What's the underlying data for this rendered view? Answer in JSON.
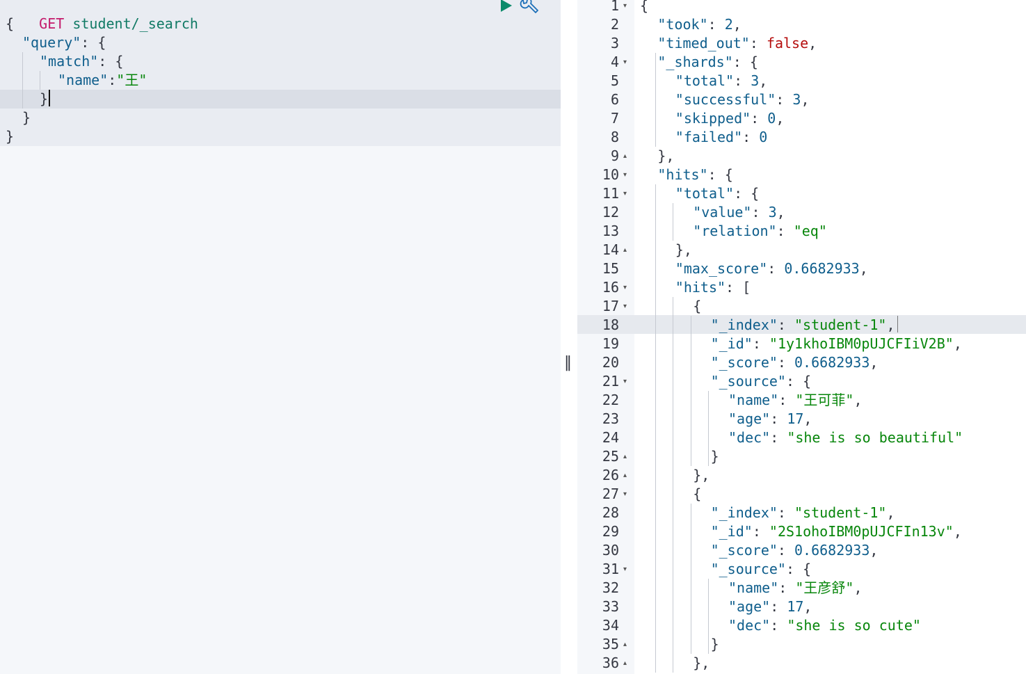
{
  "request": {
    "method": "GET",
    "path": "student/_search",
    "lines": [
      {
        "indent": 0,
        "key": "",
        "text": "{",
        "value": ""
      },
      {
        "indent": 2,
        "key": "\"query\"",
        "text": ": {",
        "value": ""
      },
      {
        "indent": 4,
        "key": "\"match\"",
        "text": ": {",
        "value": ""
      },
      {
        "indent": 6,
        "key": "\"name\"",
        "text": ":",
        "value": "\"王\""
      },
      {
        "indent": 4,
        "key": "",
        "text": "}",
        "value": ""
      },
      {
        "indent": 2,
        "key": "",
        "text": "}",
        "value": ""
      },
      {
        "indent": 0,
        "key": "",
        "text": "}",
        "value": ""
      }
    ]
  },
  "icons": {
    "run": "play-icon",
    "settings": "wrench-icon",
    "resize": "resize-handle-icon"
  },
  "resizer_glyph": "‖",
  "response": {
    "line_numbers": [
      "1",
      "2",
      "3",
      "4",
      "5",
      "6",
      "7",
      "8",
      "9",
      "10",
      "11",
      "12",
      "13",
      "14",
      "15",
      "16",
      "17",
      "18",
      "19",
      "20",
      "21",
      "22",
      "23",
      "24",
      "25",
      "26",
      "27",
      "28",
      "29",
      "30",
      "31",
      "32",
      "33",
      "34",
      "35",
      "36"
    ],
    "folds": [
      "▾",
      "",
      "",
      "▾",
      "",
      "",
      "",
      "",
      "▴",
      "▾",
      "▾",
      "",
      "",
      "▴",
      "",
      "▾",
      "▾",
      "",
      "",
      "",
      "▾",
      "",
      "",
      "",
      "▴",
      "▴",
      "▾",
      "",
      "",
      "",
      "▾",
      "",
      "",
      "",
      "▴",
      "▴"
    ],
    "lines": [
      {
        "i": 0,
        "k": "",
        "sep": "{",
        "v": "",
        "vt": ""
      },
      {
        "i": 2,
        "k": "\"took\"",
        "sep": ": ",
        "v": "2",
        "vt": "num",
        "tail": ","
      },
      {
        "i": 2,
        "k": "\"timed_out\"",
        "sep": ": ",
        "v": "false",
        "vt": "bool",
        "tail": ","
      },
      {
        "i": 2,
        "k": "\"_shards\"",
        "sep": ": {",
        "v": "",
        "vt": ""
      },
      {
        "i": 4,
        "k": "\"total\"",
        "sep": ": ",
        "v": "3",
        "vt": "num",
        "tail": ","
      },
      {
        "i": 4,
        "k": "\"successful\"",
        "sep": ": ",
        "v": "3",
        "vt": "num",
        "tail": ","
      },
      {
        "i": 4,
        "k": "\"skipped\"",
        "sep": ": ",
        "v": "0",
        "vt": "num",
        "tail": ","
      },
      {
        "i": 4,
        "k": "\"failed\"",
        "sep": ": ",
        "v": "0",
        "vt": "num"
      },
      {
        "i": 2,
        "k": "",
        "sep": "},",
        "v": "",
        "vt": ""
      },
      {
        "i": 2,
        "k": "\"hits\"",
        "sep": ": {",
        "v": "",
        "vt": ""
      },
      {
        "i": 4,
        "k": "\"total\"",
        "sep": ": {",
        "v": "",
        "vt": ""
      },
      {
        "i": 6,
        "k": "\"value\"",
        "sep": ": ",
        "v": "3",
        "vt": "num",
        "tail": ","
      },
      {
        "i": 6,
        "k": "\"relation\"",
        "sep": ": ",
        "v": "\"eq\"",
        "vt": "str"
      },
      {
        "i": 4,
        "k": "",
        "sep": "},",
        "v": "",
        "vt": ""
      },
      {
        "i": 4,
        "k": "\"max_score\"",
        "sep": ": ",
        "v": "0.6682933",
        "vt": "num",
        "tail": ","
      },
      {
        "i": 4,
        "k": "\"hits\"",
        "sep": ": [",
        "v": "",
        "vt": ""
      },
      {
        "i": 6,
        "k": "",
        "sep": "{",
        "v": "",
        "vt": ""
      },
      {
        "i": 8,
        "k": "\"_index\"",
        "sep": ": ",
        "v": "\"student-1\"",
        "vt": "str",
        "tail": ","
      },
      {
        "i": 8,
        "k": "\"_id\"",
        "sep": ": ",
        "v": "\"1y1khoIBM0pUJCFIiV2B\"",
        "vt": "str",
        "tail": ","
      },
      {
        "i": 8,
        "k": "\"_score\"",
        "sep": ": ",
        "v": "0.6682933",
        "vt": "num",
        "tail": ","
      },
      {
        "i": 8,
        "k": "\"_source\"",
        "sep": ": {",
        "v": "",
        "vt": ""
      },
      {
        "i": 10,
        "k": "\"name\"",
        "sep": ": ",
        "v": "\"王可菲\"",
        "vt": "str",
        "tail": ","
      },
      {
        "i": 10,
        "k": "\"age\"",
        "sep": ": ",
        "v": "17",
        "vt": "num",
        "tail": ","
      },
      {
        "i": 10,
        "k": "\"dec\"",
        "sep": ": ",
        "v": "\"she is so beautiful\"",
        "vt": "str"
      },
      {
        "i": 8,
        "k": "",
        "sep": "}",
        "v": "",
        "vt": ""
      },
      {
        "i": 6,
        "k": "",
        "sep": "},",
        "v": "",
        "vt": ""
      },
      {
        "i": 6,
        "k": "",
        "sep": "{",
        "v": "",
        "vt": ""
      },
      {
        "i": 8,
        "k": "\"_index\"",
        "sep": ": ",
        "v": "\"student-1\"",
        "vt": "str",
        "tail": ","
      },
      {
        "i": 8,
        "k": "\"_id\"",
        "sep": ": ",
        "v": "\"2S1ohoIBM0pUJCFIn13v\"",
        "vt": "str",
        "tail": ","
      },
      {
        "i": 8,
        "k": "\"_score\"",
        "sep": ": ",
        "v": "0.6682933",
        "vt": "num",
        "tail": ","
      },
      {
        "i": 8,
        "k": "\"_source\"",
        "sep": ": {",
        "v": "",
        "vt": ""
      },
      {
        "i": 10,
        "k": "\"name\"",
        "sep": ": ",
        "v": "\"王彦舒\"",
        "vt": "str",
        "tail": ","
      },
      {
        "i": 10,
        "k": "\"age\"",
        "sep": ": ",
        "v": "17",
        "vt": "num",
        "tail": ","
      },
      {
        "i": 10,
        "k": "\"dec\"",
        "sep": ": ",
        "v": "\"she is so cute\"",
        "vt": "str"
      },
      {
        "i": 8,
        "k": "",
        "sep": "}",
        "v": "",
        "vt": ""
      },
      {
        "i": 6,
        "k": "",
        "sep": "},",
        "v": "",
        "vt": ""
      }
    ]
  }
}
